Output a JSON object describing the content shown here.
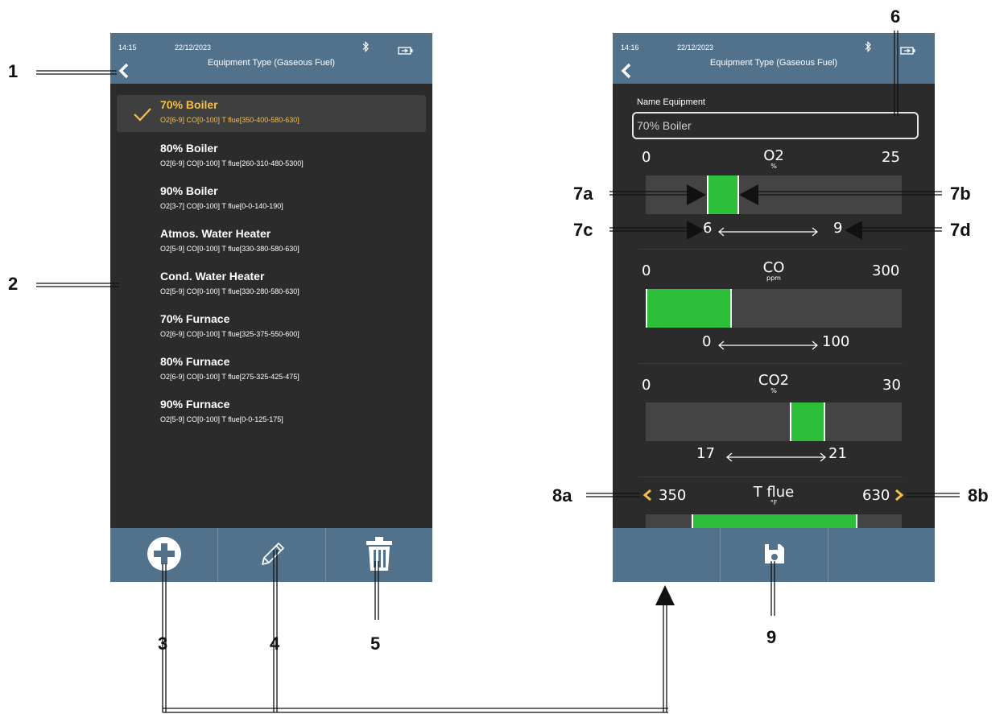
{
  "left_screen": {
    "status": {
      "time": "14:15",
      "date": "22/12/2023",
      "title": "Equipment Type (Gaseous Fuel)"
    },
    "items": [
      {
        "name": "70% Boiler",
        "spec": "O2[6-9] CO[0-100] T flue[350-400-580-630]",
        "selected": true
      },
      {
        "name": "80% Boiler",
        "spec": "O2[6-9] CO[0-100] T flue[260-310-480-5300]"
      },
      {
        "name": "90% Boiler",
        "spec": "O2[3-7] CO[0-100] T flue[0-0-140-190]"
      },
      {
        "name": "Atmos. Water Heater",
        "spec": "O2[5-9] CO[0-100] T flue[330-380-580-630]"
      },
      {
        "name": "Cond. Water Heater",
        "spec": "O2[5-9] CO[0-100] T flue[330-280-580-630]"
      },
      {
        "name": "70% Furnace",
        "spec": "O2[6-9] CO[0-100] T flue[325-375-550-600]"
      },
      {
        "name": "80% Furnace",
        "spec": "O2[6-9] CO[0-100] T flue[275-325-425-475]"
      },
      {
        "name": "90% Furnace",
        "spec": "O2[5-9] CO[0-100] T flue[0-0-125-175]"
      }
    ],
    "toolbar": [
      "add-icon",
      "pencil-icon",
      "trash-icon"
    ]
  },
  "right_screen": {
    "status": {
      "time": "14:16",
      "date": "22/12/2023",
      "title": "Equipment Type (Gaseous Fuel)"
    },
    "name_label": "Name Equipment",
    "name_value": "70% Boiler",
    "gauges": [
      {
        "title": "O2",
        "unit": "%",
        "min": "0",
        "max": "25",
        "low": "6",
        "high": "9",
        "range": [
          6,
          9
        ],
        "scale": [
          0,
          25
        ]
      },
      {
        "title": "CO",
        "unit": "ppm",
        "min": "0",
        "max": "300",
        "low": "0",
        "high": "100",
        "range": [
          0,
          100
        ],
        "scale": [
          0,
          300
        ]
      },
      {
        "title": "CO2",
        "unit": "%",
        "min": "0",
        "max": "30",
        "low": "17",
        "high": "21",
        "range": [
          17,
          21
        ],
        "scale": [
          0,
          30
        ]
      },
      {
        "title": "T flue",
        "unit": "°F",
        "min": "350",
        "max": "630"
      }
    ],
    "toolbar": [
      "save-icon"
    ]
  },
  "callouts": {
    "c1": "1",
    "c2": "2",
    "c3": "3",
    "c4": "4",
    "c5": "5",
    "c6": "6",
    "c7a": "7a",
    "c7b": "7b",
    "c7c": "7c",
    "c7d": "7d",
    "c8a": "8a",
    "c8b": "8b",
    "c9": "9"
  },
  "colors": {
    "header": "#52728c",
    "screen_bg": "#2b2b2b",
    "bar_bg": "#444444",
    "range_fill": "#2ebf3a",
    "selected_text": "#f4c04a"
  }
}
